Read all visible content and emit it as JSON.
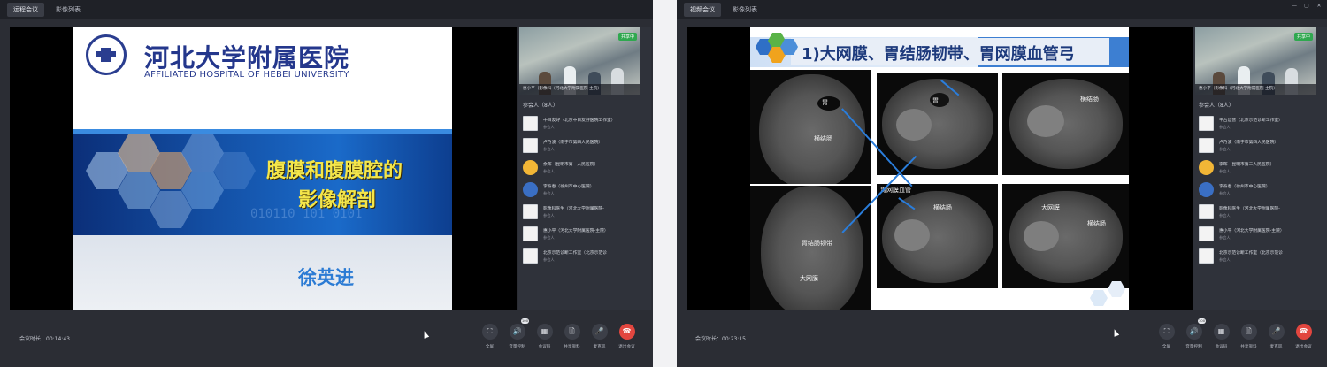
{
  "windows": [
    {
      "tabs": [
        "远程会议",
        "影像列表"
      ],
      "slide": {
        "hospital_cn": "河北大学附属医院",
        "hospital_en": "AFFILIATED HOSPITAL OF HEBEI UNIVERSITY",
        "title_line1": "腹膜和腹膜腔的",
        "title_line2": "影像解剖",
        "binary": "010110  101  0101",
        "author": "徐英进"
      },
      "video": {
        "badge": "共享中",
        "caption": "惠小平（影像科（河北大学附属医院-主院）"
      },
      "participants_title": "参会人（8人）",
      "participants": [
        {
          "name": "中日友好（北京中日友好医院工作室）",
          "role": "参会人"
        },
        {
          "name": "卢乃波（南宁市第四人民医院）",
          "role": "参会人"
        },
        {
          "name": "余晖（昆明市第一人民医院）",
          "role": "参会人"
        },
        {
          "name": "李泰春（徐州市中心医院）",
          "role": "参会人"
        },
        {
          "name": "影像科医生（河北大学附属医院-",
          "role": "参会人"
        },
        {
          "name": "惠小平（河北大学附属医院-主院）",
          "role": "参会人"
        },
        {
          "name": "北京示范诊断工作室（北京示范诊",
          "role": "参会人"
        }
      ],
      "duration": "会议时长：00:14:43",
      "controls": [
        {
          "label": "全屏",
          "glyph": "⛶"
        },
        {
          "label": "音量控制",
          "glyph": "🔊",
          "badge": "100"
        },
        {
          "label": "会议码",
          "glyph": "▦"
        },
        {
          "label": "共享资料",
          "glyph": "🗎"
        },
        {
          "label": "麦克风",
          "glyph": "🎤"
        },
        {
          "label": "退出会议",
          "glyph": "☎"
        }
      ]
    },
    {
      "tabs": [
        "视频会议",
        "影像列表"
      ],
      "slide": {
        "title": "1)大网膜、胃结肠韧带、胃网膜血管弓",
        "ct_labels": [
          "胃",
          "横结肠",
          "胃",
          "横结肠",
          "胃网膜血管",
          "胃结肠韧带",
          "横结肠",
          "大网膜",
          "横结肠",
          "大网膜"
        ]
      },
      "video": {
        "badge": "共享中",
        "caption": "惠小平（影像科（河北大学附属医院-主院）"
      },
      "participants_title": "参会人（8人）",
      "participants": [
        {
          "name": "平台运营（北京示范诊断工作室）",
          "role": "参会人"
        },
        {
          "name": "卢乃波（南宁市第四人民医院）",
          "role": "参会人"
        },
        {
          "name": "李晖（昆明市第二人民医院）",
          "role": "参会人"
        },
        {
          "name": "李泰春（徐州市中心医院）",
          "role": "参会人"
        },
        {
          "name": "影像科医生（河北大学附属医院-",
          "role": "参会人"
        },
        {
          "name": "惠小平（河北大学附属医院-主院）",
          "role": "参会人"
        },
        {
          "name": "北京示范诊断工作室（北京示范诊",
          "role": "参会人"
        }
      ],
      "duration": "会议时长：00:23:15",
      "controls": [
        {
          "label": "全屏",
          "glyph": "⛶"
        },
        {
          "label": "音量控制",
          "glyph": "🔊",
          "badge": "100"
        },
        {
          "label": "会议码",
          "glyph": "▦"
        },
        {
          "label": "共享资料",
          "glyph": "🗎"
        },
        {
          "label": "麦克风",
          "glyph": "🎤"
        },
        {
          "label": "退出会议",
          "glyph": "☎"
        }
      ],
      "window_controls": [
        "—",
        "▢",
        "✕"
      ]
    }
  ]
}
